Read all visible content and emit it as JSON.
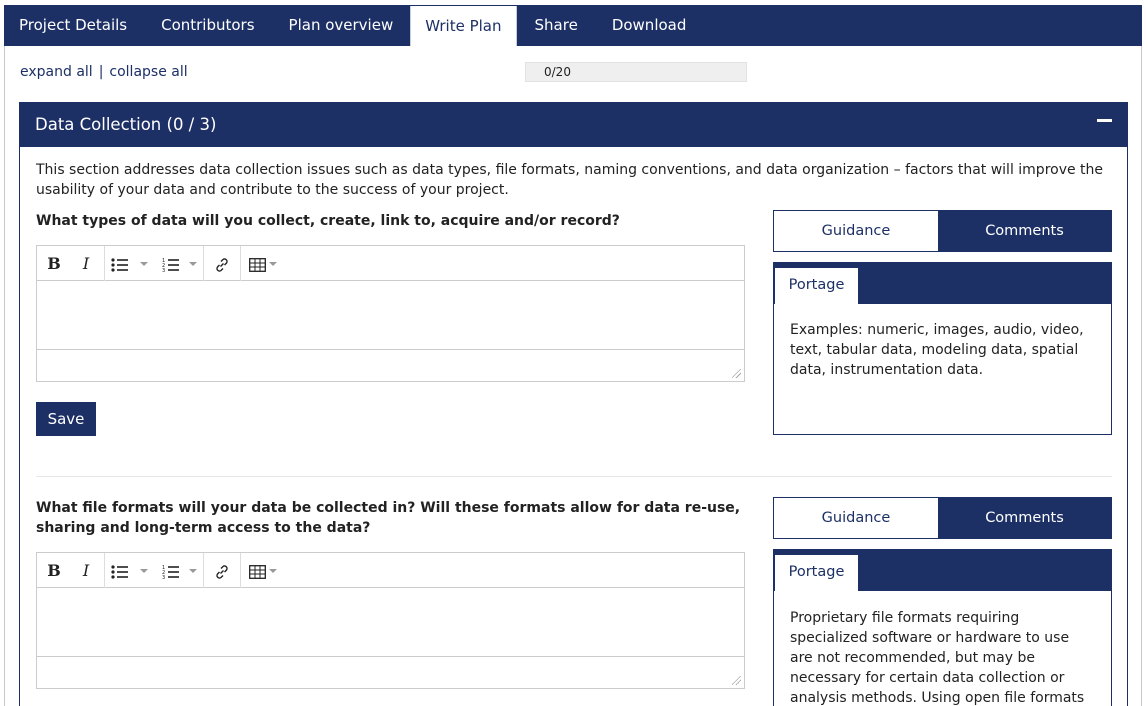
{
  "tabs": [
    {
      "label": "Project Details"
    },
    {
      "label": "Contributors"
    },
    {
      "label": "Plan overview"
    },
    {
      "label": "Write Plan"
    },
    {
      "label": "Share"
    },
    {
      "label": "Download"
    }
  ],
  "active_tab": "Write Plan",
  "expand_all": "expand all",
  "separator": "|",
  "collapse_all": "collapse all",
  "progress": {
    "text": "0/20",
    "answered": 0,
    "total": 20
  },
  "section": {
    "title": "Data Collection (0 / 3)",
    "description": "This section addresses data collection issues such as data types, file formats, naming conventions, and data organization – factors that will improve the usability of your data and contribute to the success of your project."
  },
  "questions": [
    {
      "text": "What types of data will you collect, create, link to, acquire and/or record?",
      "save_label": "Save",
      "guidance_tab": "Guidance",
      "comments_tab": "Comments",
      "guidance_source": "Portage",
      "guidance_text": "Examples: numeric, images, audio, video, text, tabular data, modeling data, spatial data, instrumentation data."
    },
    {
      "text": "What file formats will your data be collected in? Will these formats allow for data re-use, sharing and long-term access to the data?",
      "guidance_tab": "Guidance",
      "comments_tab": "Comments",
      "guidance_source": "Portage",
      "guidance_text": "Proprietary file formats requiring specialized software or hardware to use are not recommended, but may be necessary for certain data collection or analysis methods. Using open file formats"
    }
  ],
  "toolbar": {
    "bold": "B",
    "italic": "I",
    "icons": [
      "bold-icon",
      "italic-icon",
      "bullet-list-icon",
      "numbered-list-icon",
      "link-icon",
      "table-icon"
    ]
  },
  "colors": {
    "primary": "#1d3066",
    "background": "#ffffff"
  }
}
